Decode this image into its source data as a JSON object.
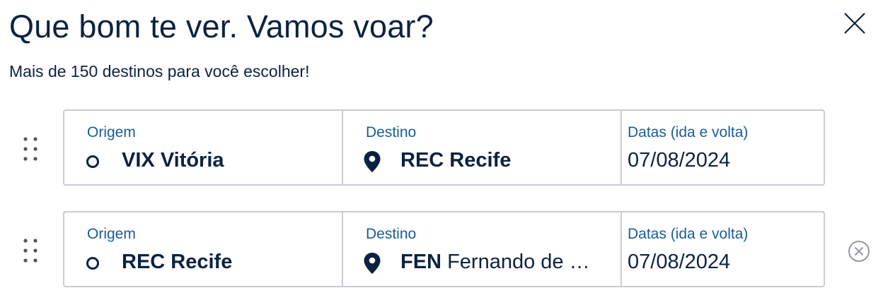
{
  "header": {
    "title": "Que bom te ver. Vamos voar?",
    "subtitle": "Mais de 150 destinos para você escolher!"
  },
  "segments": [
    {
      "origin_label": "Origem",
      "origin_code": "VIX",
      "origin_city": "Vitória",
      "destination_label": "Destino",
      "destination_code": "REC",
      "destination_city": "Recife",
      "dates_label": "Datas (ida e volta)",
      "dates_value": "07/08/2024"
    },
    {
      "origin_label": "Origem",
      "origin_code": "REC",
      "origin_city": "Recife",
      "destination_label": "Destino",
      "destination_code": "FEN",
      "destination_city": "Fernando de Noronha",
      "dates_label": "Datas (ida e volta)",
      "dates_value": "07/08/2024"
    }
  ],
  "icons": {
    "close": "close-icon",
    "drag": "drag-handle-icon",
    "origin": "circle-outline-icon",
    "destination": "location-pin-icon",
    "remove": "circle-x-icon"
  },
  "colors": {
    "text": "#0b2341",
    "label": "#1a5c96",
    "border": "#c9ccd1"
  }
}
